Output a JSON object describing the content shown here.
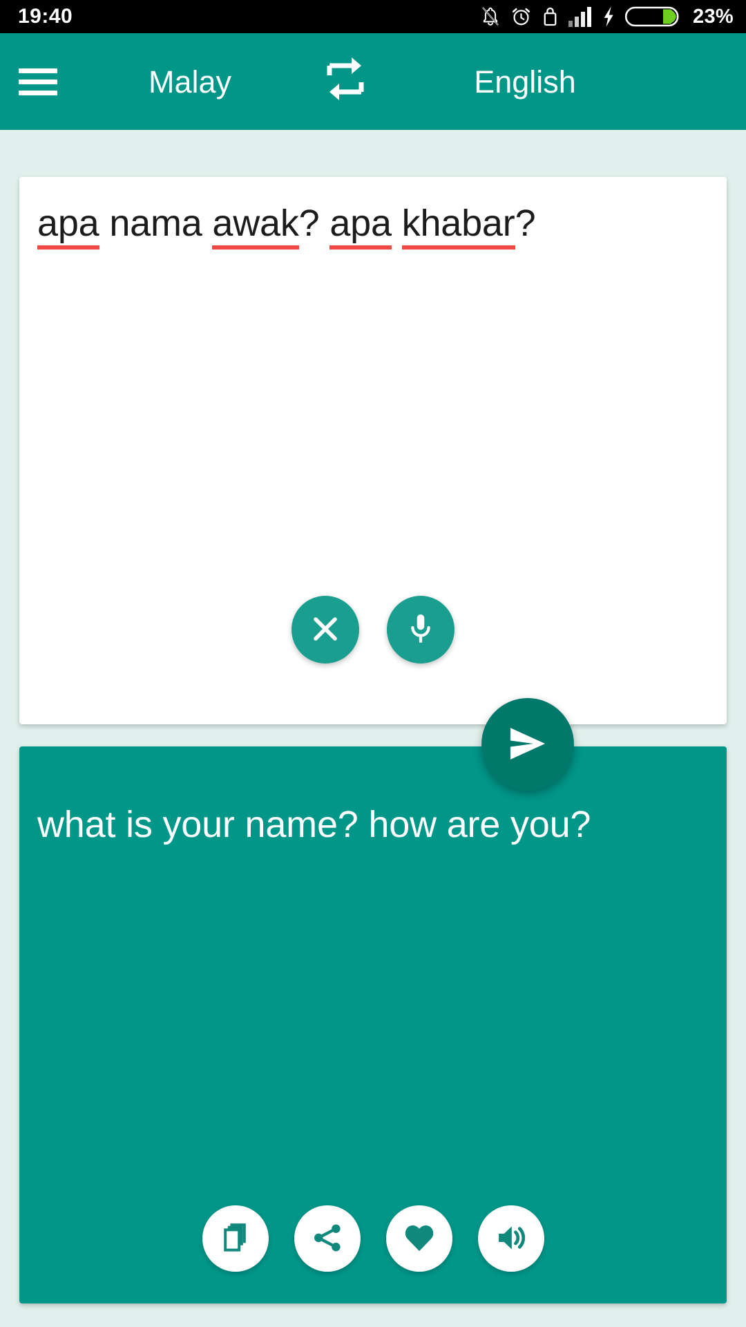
{
  "status_bar": {
    "time": "19:40",
    "battery_percent": "23%",
    "icons": [
      "notifications-off-icon",
      "alarm-clock-icon",
      "screen-lock-icon",
      "signal-bars-icon",
      "charging-bolt-icon",
      "battery-icon"
    ],
    "background_color": "#000000",
    "text_color": "#ffffff",
    "battery_fill_color": "#6ecf20"
  },
  "header": {
    "menu_icon": "hamburger-menu-icon",
    "source_language": "Malay",
    "swap_icon": "swap-languages-icon",
    "target_language": "English",
    "background_color": "#009688"
  },
  "source_panel": {
    "text": "apa nama awak? apa khabar?",
    "tokens": [
      {
        "text": "apa",
        "misspelled": true
      },
      {
        "text": "nama",
        "misspelled": false
      },
      {
        "text": "awak?",
        "misspelled": true,
        "underline_only": "awak"
      },
      {
        "text": "apa",
        "misspelled": true
      },
      {
        "text": "khabar?",
        "misspelled": true,
        "underline_only": "khabar"
      }
    ],
    "spellcheck_underline_color": "#ef4b42",
    "background_color": "#ffffff",
    "text_color": "#1c1c1c",
    "actions": [
      {
        "name": "clear-button",
        "icon": "close-x-icon"
      },
      {
        "name": "microphone-button",
        "icon": "microphone-icon"
      }
    ]
  },
  "send_button": {
    "icon": "send-icon",
    "background_color": "#00796b"
  },
  "result_panel": {
    "text": "what is your name? how are you?",
    "background_color": "#009688",
    "text_color": "#ffffff",
    "actions": [
      {
        "name": "copy-button",
        "icon": "copy-icon"
      },
      {
        "name": "share-button",
        "icon": "share-icon"
      },
      {
        "name": "favorite-button",
        "icon": "heart-icon"
      },
      {
        "name": "speak-button",
        "icon": "speaker-volume-icon"
      }
    ]
  },
  "page": {
    "background_color": "#e2f0ed"
  }
}
